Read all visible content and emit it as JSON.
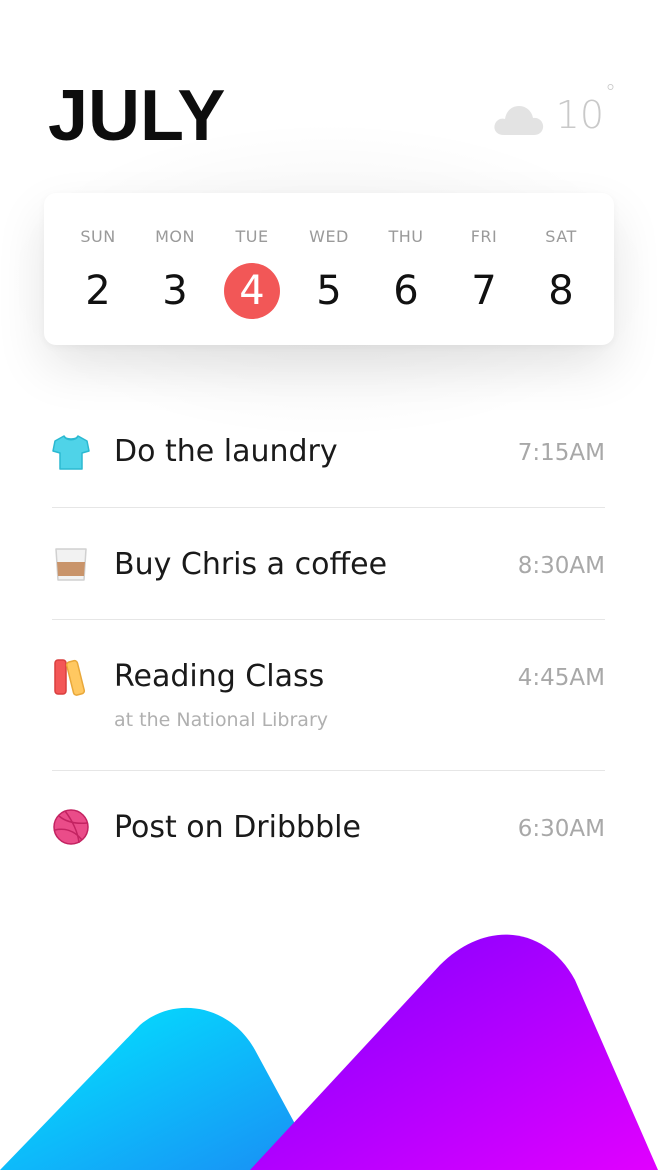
{
  "header": {
    "month": "JULY",
    "weather_icon": "cloud-icon",
    "temperature": "10",
    "degree_symbol": "°"
  },
  "week": {
    "days": [
      {
        "name": "SUN",
        "date": "2",
        "selected": false
      },
      {
        "name": "MON",
        "date": "3",
        "selected": false
      },
      {
        "name": "TUE",
        "date": "4",
        "selected": true
      },
      {
        "name": "WED",
        "date": "5",
        "selected": false
      },
      {
        "name": "THU",
        "date": "6",
        "selected": false
      },
      {
        "name": "FRI",
        "date": "7",
        "selected": false
      },
      {
        "name": "SAT",
        "date": "8",
        "selected": false
      }
    ],
    "selected_color": "#f25757"
  },
  "tasks": [
    {
      "icon": "tshirt-icon",
      "title": "Do the laundry",
      "subtitle": "",
      "time": "7:15AM"
    },
    {
      "icon": "coffee-cup-icon",
      "title": "Buy Chris a coffee",
      "subtitle": "",
      "time": "8:30AM"
    },
    {
      "icon": "books-icon",
      "title": "Reading Class",
      "subtitle": "at the National Library",
      "time": "4:45AM"
    },
    {
      "icon": "dribbble-ball-icon",
      "title": "Post on Dribbble",
      "subtitle": "",
      "time": "6:30AM"
    }
  ],
  "colors": {
    "mountain_left": "#14d8f6",
    "mountain_right": "#b400ff",
    "accent_red": "#f25757"
  }
}
